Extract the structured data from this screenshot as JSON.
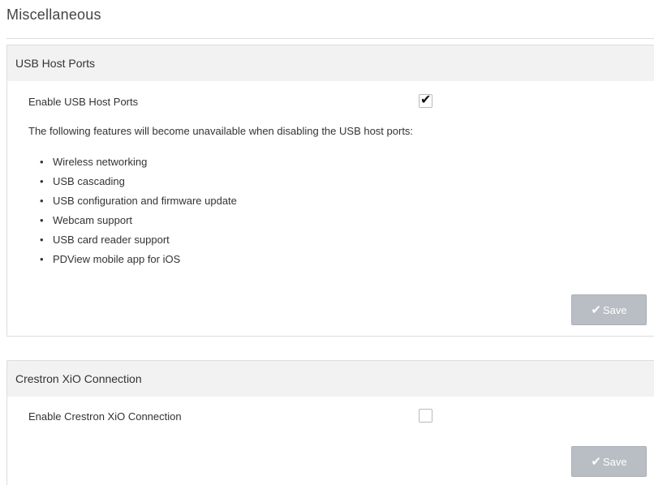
{
  "page": {
    "title": "Miscellaneous"
  },
  "usb": {
    "header": "USB Host Ports",
    "enable_label": "Enable USB Host Ports",
    "enable_checked": true,
    "check_glyph": "✔",
    "note": "The following features will become unavailable when disabling the USB host ports:",
    "bullet_glyph": "•",
    "features": [
      "Wireless networking",
      "USB cascading",
      "USB configuration and firmware update",
      "Webcam support",
      "USB card reader support",
      "PDView mobile app for iOS"
    ],
    "save_label": "Save",
    "save_icon": "✔"
  },
  "xio": {
    "header": "Crestron XiO Connection",
    "enable_label": "Enable Crestron XiO Connection",
    "enable_checked": false,
    "save_label": "Save",
    "save_icon": "✔"
  },
  "colors": {
    "header_bg": "#f2f2f2",
    "button_bg": "#b9bec4",
    "border": "#dddddd"
  }
}
